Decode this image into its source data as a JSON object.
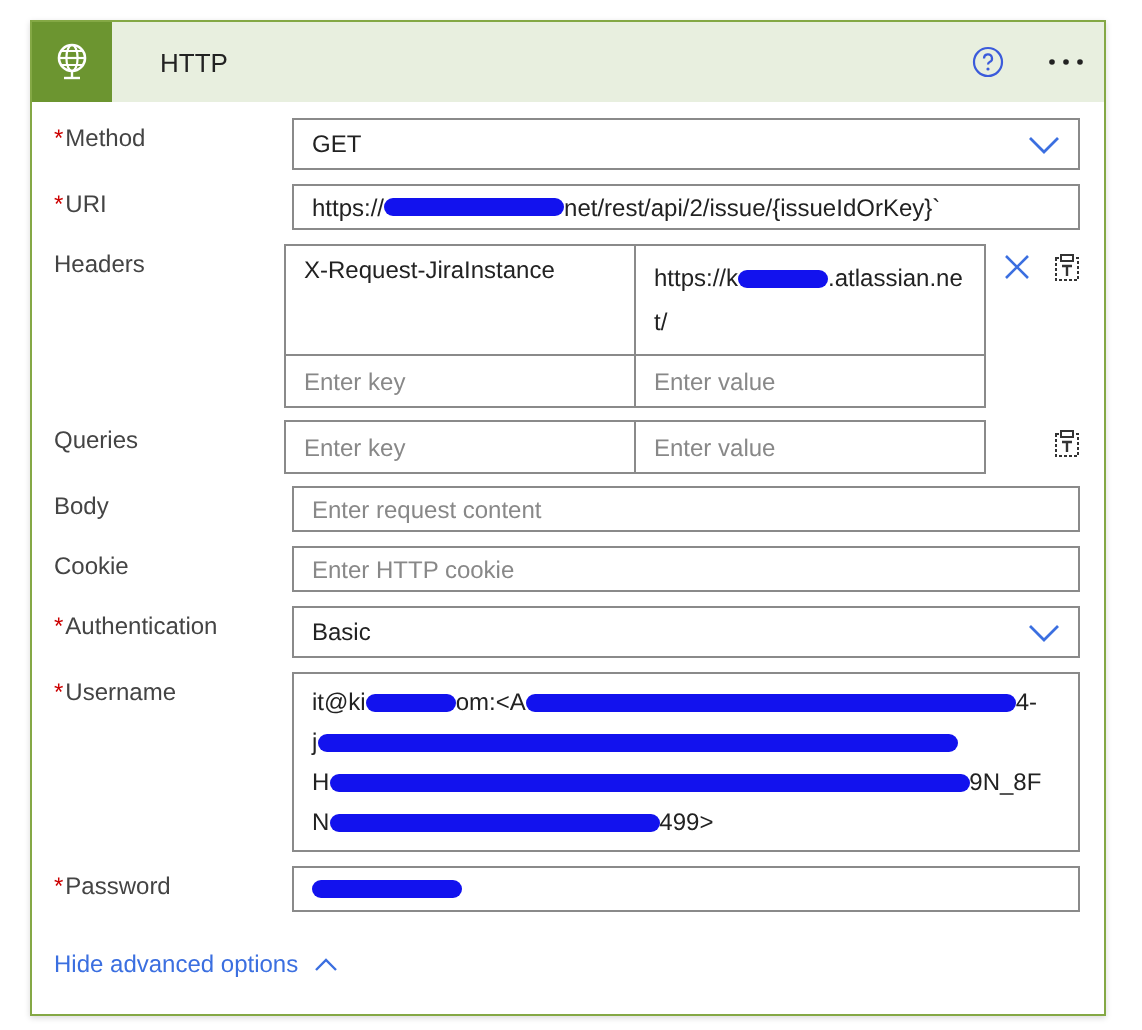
{
  "card": {
    "title": "HTTP",
    "required_mark": "*",
    "fields": [
      {
        "kind": "select",
        "label": "Method",
        "required": true,
        "lines": [
          [
            {
              "kind": "text",
              "text": "GET"
            }
          ]
        ]
      },
      {
        "kind": "text",
        "label": "URI",
        "required": true,
        "lines": [
          [
            {
              "kind": "text",
              "text": "https://"
            },
            {
              "kind": "redaction"
            },
            {
              "kind": "text",
              "text": "net/rest/api/2/issue/{issueIdOrKey}`"
            }
          ]
        ]
      },
      {
        "kind": "keyvalue",
        "label": "Headers",
        "required": false,
        "removable": true,
        "rows": [
          {
            "key": "X-Request-JiraInstance",
            "value_lines": [
              [
                {
                  "kind": "text",
                  "text": "https://k"
                },
                {
                  "kind": "redaction"
                },
                {
                  "kind": "text",
                  "text": ".atlassian.ne"
                }
              ],
              [
                {
                  "kind": "text",
                  "text": "t/"
                }
              ]
            ]
          },
          {
            "key_placeholder": "Enter key",
            "value_placeholder": "Enter value"
          }
        ]
      },
      {
        "kind": "keyvalue",
        "label": "Queries",
        "required": false,
        "removable": false,
        "rows": [
          {
            "key_placeholder": "Enter key",
            "value_placeholder": "Enter value"
          }
        ]
      },
      {
        "kind": "text",
        "label": "Body",
        "required": false,
        "placeholder": "Enter request content"
      },
      {
        "kind": "text",
        "label": "Cookie",
        "required": false,
        "placeholder": "Enter HTTP cookie"
      },
      {
        "kind": "select",
        "label": "Authentication",
        "required": true,
        "lines": [
          [
            {
              "kind": "text",
              "text": "Basic"
            }
          ]
        ]
      },
      {
        "kind": "multiline",
        "label": "Username",
        "required": true,
        "lines": [
          [
            {
              "kind": "text",
              "text": "it@ki"
            },
            {
              "kind": "redaction"
            },
            {
              "kind": "text",
              "text": "om:<A"
            },
            {
              "kind": "redaction"
            },
            {
              "kind": "text",
              "text": "4-"
            }
          ],
          [
            {
              "kind": "text",
              "text": "j"
            },
            {
              "kind": "redaction"
            }
          ],
          [
            {
              "kind": "text",
              "text": "H"
            },
            {
              "kind": "redaction"
            },
            {
              "kind": "text",
              "text": "9N_8F"
            }
          ],
          [
            {
              "kind": "text",
              "text": "N"
            },
            {
              "kind": "redaction"
            },
            {
              "kind": "text",
              "text": "499>"
            }
          ]
        ]
      },
      {
        "kind": "text",
        "label": "Password",
        "required": true,
        "lines": [
          [
            {
              "kind": "redaction"
            }
          ]
        ]
      }
    ],
    "advanced_link": "Hide advanced options"
  }
}
